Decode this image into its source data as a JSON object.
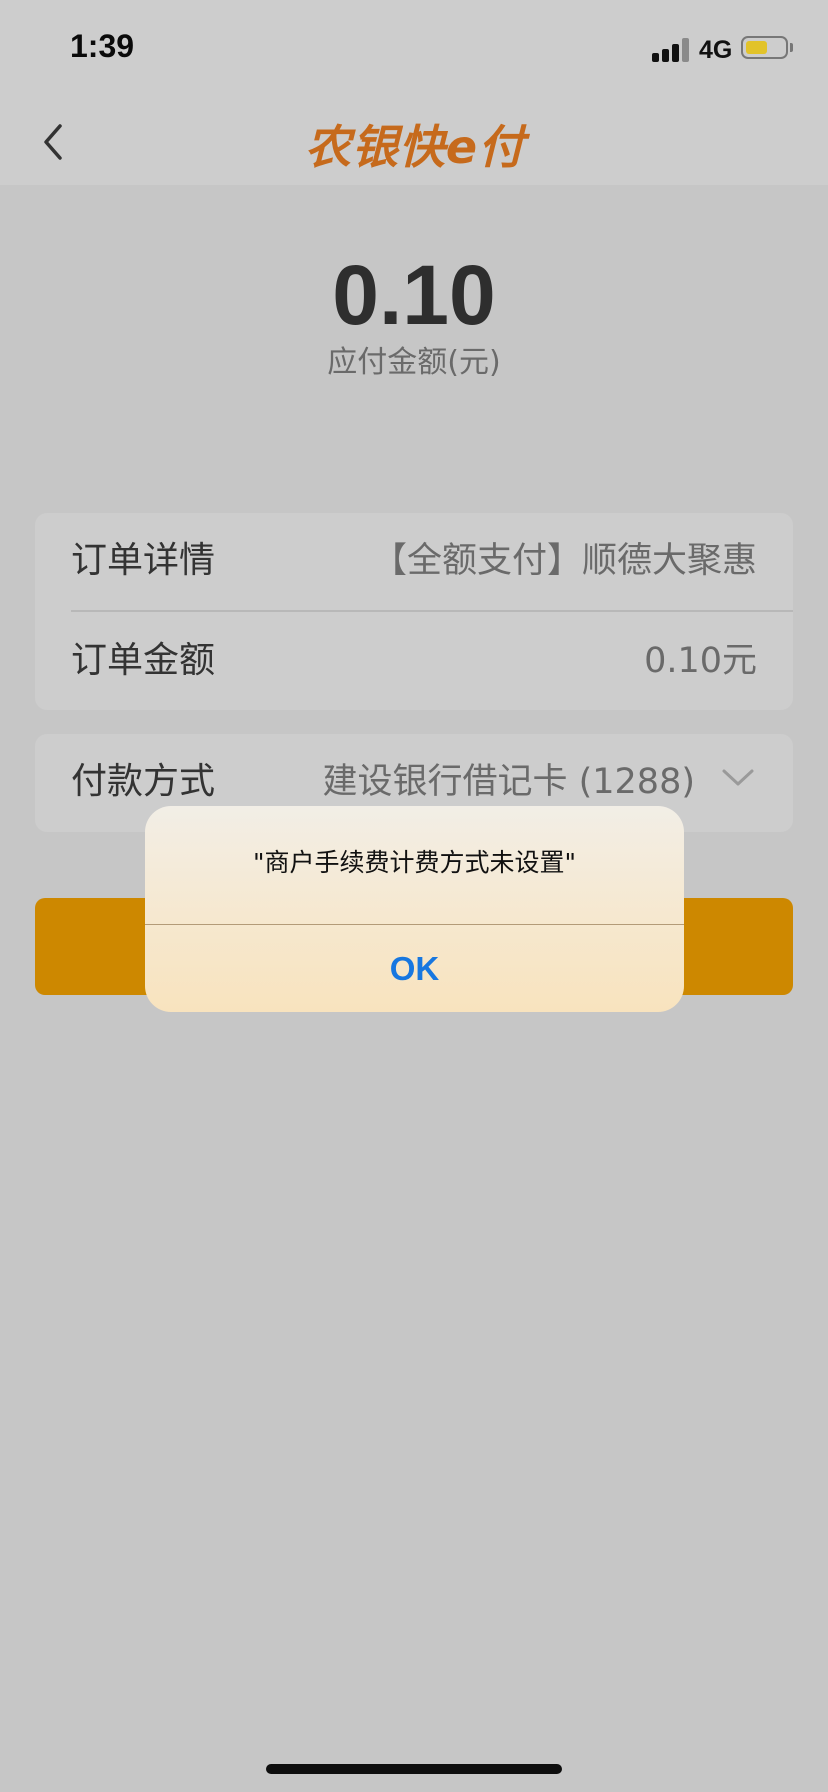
{
  "status_bar": {
    "time": "1:39",
    "network": "4G",
    "battery_level_percent": 50,
    "battery_color": "#e2c32a"
  },
  "nav": {
    "back_icon": "chevron-left-icon",
    "brand_logo": "农银快e付",
    "brand_color": "#c66a1c"
  },
  "payment": {
    "amount": "0.10",
    "amount_label": "应付金额(元)"
  },
  "order": {
    "detail_label": "订单详情",
    "detail_value": "【全额支付】顺德大聚惠",
    "amount_label": "订单金额",
    "amount_value": "0.10元"
  },
  "payment_method": {
    "label": "付款方式",
    "value": "建设银行借记卡 (1288)",
    "dropdown_icon": "chevron-down-icon"
  },
  "confirm_button": {
    "color": "#cd8800"
  },
  "alert": {
    "message": "\"商户手续费计费方式未设置\"",
    "ok_label": "OK",
    "ok_color": "#1777e0"
  }
}
